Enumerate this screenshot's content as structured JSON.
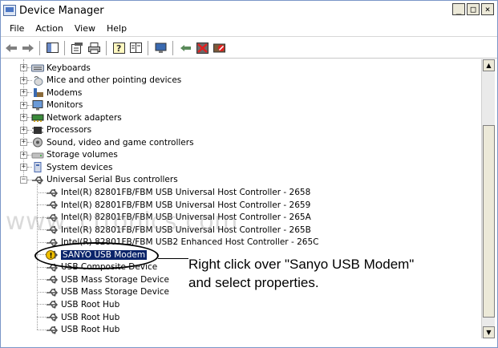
{
  "window": {
    "title": "Device Manager",
    "controls": {
      "minimize": "_",
      "maximize": "□",
      "close": "×"
    }
  },
  "menu": [
    "File",
    "Action",
    "View",
    "Help"
  ],
  "toolbar": {
    "buttons": [
      "back-icon",
      "forward-icon",
      "sep",
      "show-hide-tree-icon",
      "sep",
      "properties-icon",
      "print-icon",
      "sep",
      "help-icon",
      "view-icon",
      "sep",
      "update-driver-icon",
      "sep",
      "scan-hardware-icon",
      "uninstall-icon",
      "disable-icon"
    ]
  },
  "tree": {
    "categories": [
      {
        "label": "Keyboards",
        "icon": "keyboard-icon",
        "color": "#5a6e8c"
      },
      {
        "label": "Mice and other pointing devices",
        "icon": "mouse-icon",
        "color": "#7a8a9a"
      },
      {
        "label": "Modems",
        "icon": "modem-icon",
        "color": "#8a6a3a"
      },
      {
        "label": "Monitors",
        "icon": "monitor-icon",
        "color": "#3a6ab0"
      },
      {
        "label": "Network adapters",
        "icon": "network-icon",
        "color": "#3a8a3a"
      },
      {
        "label": "Processors",
        "icon": "processor-icon",
        "color": "#303030"
      },
      {
        "label": "Sound, video and game controllers",
        "icon": "sound-icon",
        "color": "#5a5a5a"
      },
      {
        "label": "Storage volumes",
        "icon": "storage-icon",
        "color": "#8a8a8a"
      },
      {
        "label": "System devices",
        "icon": "system-icon",
        "color": "#4a6ab0"
      },
      {
        "label": "Universal Serial Bus controllers",
        "icon": "usb-icon",
        "color": "#505050"
      }
    ],
    "usb_children": [
      {
        "label": "Intel(R) 82801FB/FBM USB Universal Host Controller - 2658"
      },
      {
        "label": "Intel(R) 82801FB/FBM USB Universal Host Controller - 2659"
      },
      {
        "label": "Intel(R) 82801FB/FBM USB Universal Host Controller - 265A"
      },
      {
        "label": "Intel(R) 82801FB/FBM USB Universal Host Controller - 265B"
      },
      {
        "label": "Intel(R) 82801FB/FBM USB2 Enhanced Host Controller - 265C"
      },
      {
        "label": "SANYO USB Modem",
        "selected": true,
        "warning": true
      },
      {
        "label": "USB Composite Device"
      },
      {
        "label": "USB Mass Storage Device"
      },
      {
        "label": "USB Mass Storage Device"
      },
      {
        "label": "USB Root Hub"
      },
      {
        "label": "USB Root Hub"
      },
      {
        "label": "USB Root Hub"
      }
    ]
  },
  "watermark": "www.                                    ctronics.com",
  "annotation": {
    "line1": "Right click over \"Sanyo USB Modem\"",
    "line2": "and select properties."
  },
  "colors": {
    "selection": "#0a246a",
    "warning": "#f0c000"
  }
}
